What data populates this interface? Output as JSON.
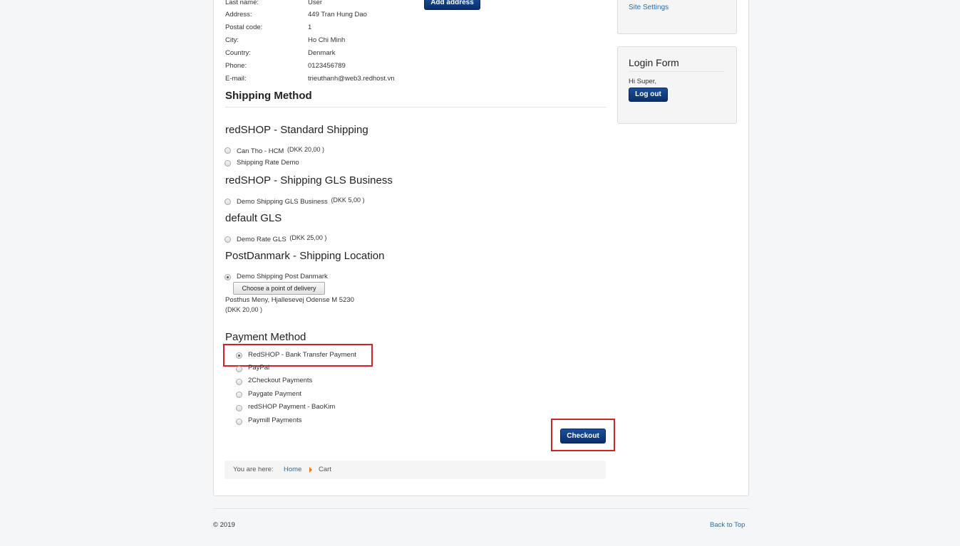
{
  "address": {
    "rows": [
      {
        "label": "Last name:",
        "value": "User"
      },
      {
        "label": "Address:",
        "value": "449 Tran Hung Dao"
      },
      {
        "label": "Postal code:",
        "value": "1"
      },
      {
        "label": "City:",
        "value": "Ho Chi Minh"
      },
      {
        "label": "Country:",
        "value": "Denmark"
      },
      {
        "label": "Phone:",
        "value": "0123456789"
      },
      {
        "label": "E-mail:",
        "value": "trieuthanh@web3.redhost.vn"
      }
    ],
    "add_button": "Add address"
  },
  "shipping": {
    "title": "Shipping Method",
    "groups": [
      {
        "name": "redSHOP - Standard Shipping",
        "options": [
          {
            "label": "Can Tho - HCM",
            "price": "(DKK 20,00 )",
            "selected": false
          },
          {
            "label": "Shipping Rate Demo",
            "price": "",
            "selected": false
          }
        ]
      },
      {
        "name": "redSHOP - Shipping GLS Business",
        "options": [
          {
            "label": "Demo Shipping GLS Business",
            "price": "(DKK 5,00 )",
            "selected": false
          }
        ]
      },
      {
        "name": "default GLS",
        "options": [
          {
            "label": "Demo Rate GLS",
            "price": "(DKK 25,00 )",
            "selected": false
          }
        ]
      },
      {
        "name": "PostDanmark - Shipping Location",
        "options": [
          {
            "label": "Demo Shipping Post Danmark",
            "price": "",
            "selected": true
          }
        ],
        "choose_button": "Choose a point of delivery",
        "delivery_point": "Posthus Meny, Hjallesevej Odense M 5230",
        "delivery_price": "(DKK 20,00 )"
      }
    ]
  },
  "payment": {
    "title": "Payment Method",
    "options": [
      {
        "label": "RedSHOP - Bank Transfer Payment",
        "selected": true
      },
      {
        "label": "PayPal",
        "selected": false
      },
      {
        "label": "2Checkout Payments",
        "selected": false
      },
      {
        "label": "Paygate Payment",
        "selected": false
      },
      {
        "label": "redSHOP Payment - BaoKim",
        "selected": false
      },
      {
        "label": "Paymill Payments",
        "selected": false
      }
    ]
  },
  "checkout_button": "Checkout",
  "breadcrumb": {
    "prefix": "You are here:",
    "items": [
      "Home",
      "Cart"
    ]
  },
  "sidebar": {
    "site_settings_link": "Site Settings",
    "login": {
      "title": "Login Form",
      "greeting": "Hi Super,",
      "logout_button": "Log out"
    }
  },
  "footer": {
    "copyright": "© 2019",
    "back_to_top": "Back to Top"
  },
  "colors": {
    "primary_button": "#0a2f6b",
    "link": "#2a6ea8",
    "highlight_box": "#d0222a",
    "breadcrumb_separator": "#e07b22"
  }
}
